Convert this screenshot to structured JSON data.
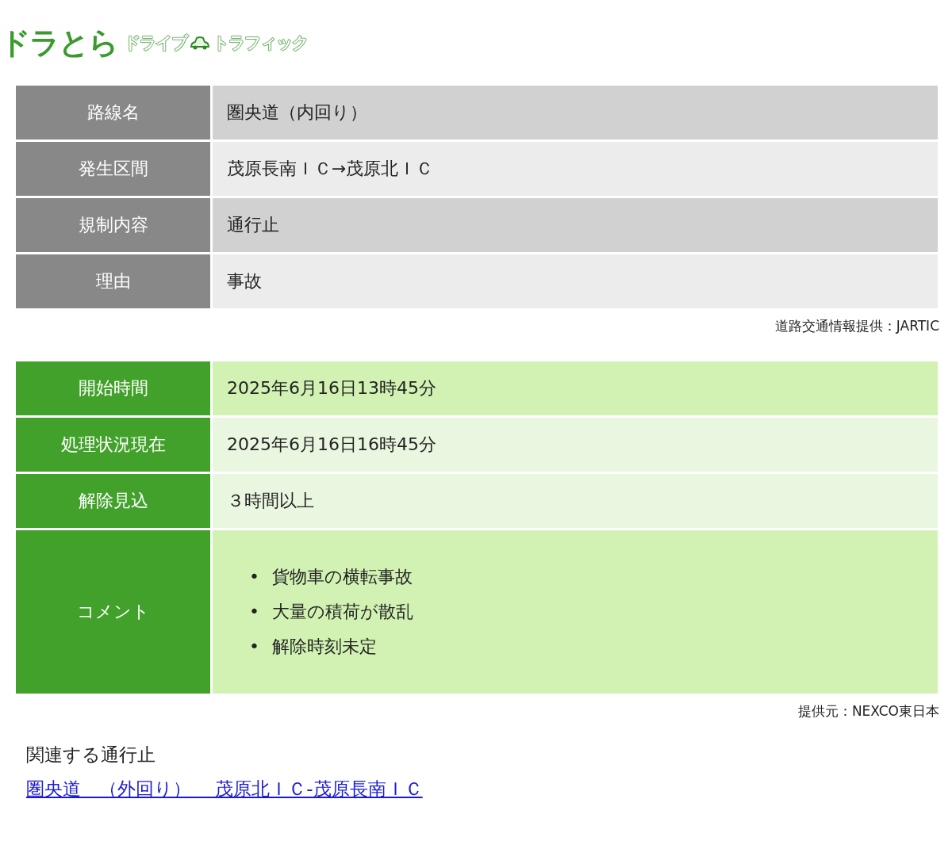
{
  "logo": {
    "main": "ドラとら",
    "sub_left": "ドライブ",
    "sub_right": "トラフィック"
  },
  "regulation_table": {
    "rows": [
      {
        "label": "路線名",
        "value": "圏央道（内回り）",
        "color": "#d1d1d1"
      },
      {
        "label": "発生区間",
        "value": "茂原長南ＩＣ→茂原北ＩＣ",
        "color": "#ececec"
      },
      {
        "label": "規制内容",
        "value": "通行止",
        "color": "#d1d1d1"
      },
      {
        "label": "理由",
        "value": "事故",
        "color": "#ececec"
      }
    ],
    "source": "道路交通情報提供：JARTIC"
  },
  "status_table": {
    "rows": [
      {
        "label": "開始時間",
        "kind": "text",
        "value": "2025年6月16日13時45分",
        "color": "#d2f2b4"
      },
      {
        "label": "処理状況現在",
        "kind": "text",
        "value": "2025年6月16日16時45分",
        "color": "#eaf7e0"
      },
      {
        "label": "解除見込",
        "kind": "text",
        "value": "３時間以上",
        "color": "#eaf7e0"
      },
      {
        "label": "コメント",
        "kind": "list",
        "bullet": "•",
        "items": [
          "貨物車の横転事故",
          "大量の積荷が散乱",
          "解除時刻未定"
        ],
        "color": "#d2f2b4"
      }
    ],
    "source": "提供元：NEXCO東日本"
  },
  "related": {
    "heading": "関連する通行止",
    "links": [
      "圏央道　（外回り）　 茂原北ＩＣ-茂原長南ＩＣ"
    ]
  }
}
